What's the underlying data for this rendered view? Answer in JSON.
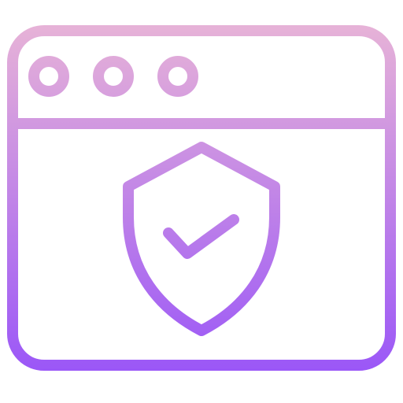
{
  "icon": {
    "name": "secure-browser-window-icon",
    "window": {
      "titlebar_buttons": [
        "window-control-dot",
        "window-control-dot",
        "window-control-dot"
      ]
    },
    "content": {
      "badge": "shield-check-icon"
    }
  },
  "colors": {
    "gradient_top": "#E7B3D7",
    "gradient_bottom": "#9B57F7",
    "background": "#FFFFFF"
  }
}
